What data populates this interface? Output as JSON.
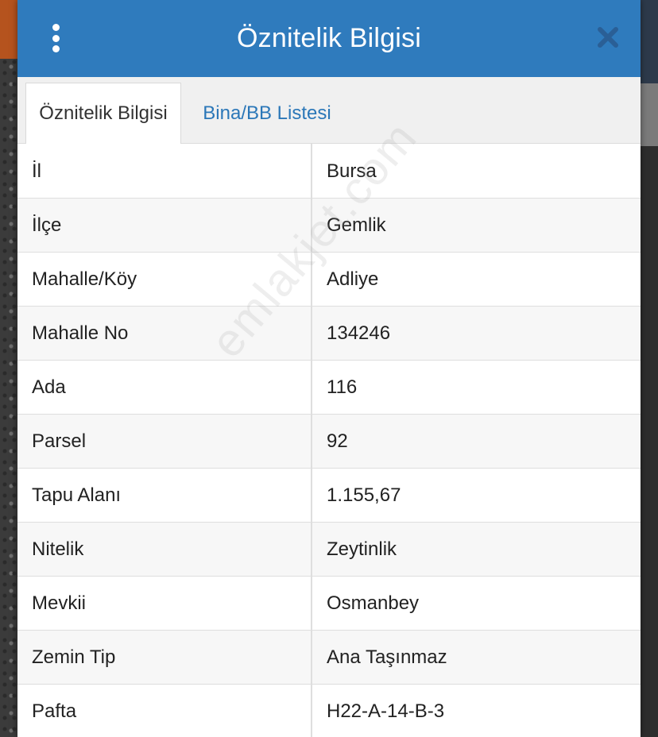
{
  "dialog": {
    "title": "Öznitelik Bilgisi"
  },
  "tabs": [
    {
      "label": "Öznitelik Bilgisi",
      "active": true
    },
    {
      "label": "Bina/BB Listesi",
      "active": false
    }
  ],
  "rows": [
    {
      "key": "İl",
      "value": "Bursa"
    },
    {
      "key": "İlçe",
      "value": "Gemlik"
    },
    {
      "key": "Mahalle/Köy",
      "value": "Adliye"
    },
    {
      "key": "Mahalle No",
      "value": "134246"
    },
    {
      "key": "Ada",
      "value": "116"
    },
    {
      "key": "Parsel",
      "value": "92"
    },
    {
      "key": "Tapu Alanı",
      "value": "1.155,67"
    },
    {
      "key": "Nitelik",
      "value": "Zeytinlik"
    },
    {
      "key": "Mevkii",
      "value": "Osmanbey"
    },
    {
      "key": "Zemin Tip",
      "value": "Ana Taşınmaz"
    },
    {
      "key": "Pafta",
      "value": "H22-A-14-B-3"
    }
  ],
  "watermark": "emlakjet.com",
  "colors": {
    "header": "#2f7bbd",
    "tab_link": "#2b77b8",
    "close": "#2a5f96"
  },
  "icons": {
    "menu": "kebab-menu-icon",
    "close": "close-icon"
  }
}
